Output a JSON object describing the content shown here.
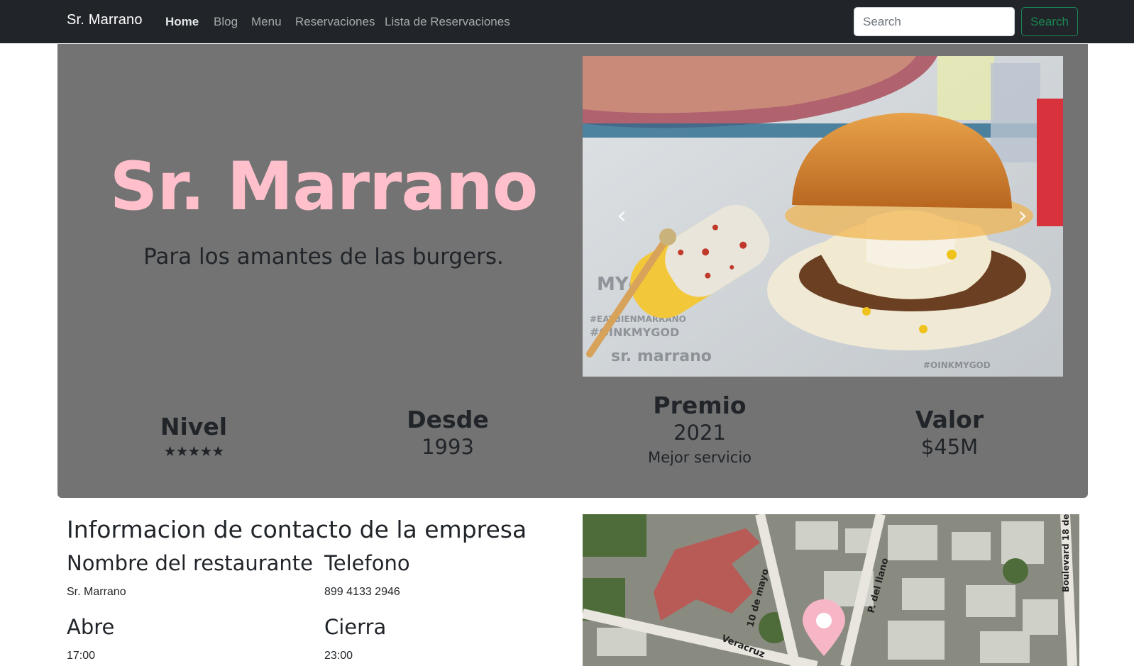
{
  "navbar": {
    "brand": "Sr. Marrano",
    "links": [
      "Home",
      "Blog",
      "Menu",
      "Reservaciones",
      "Lista de Reservaciones"
    ],
    "search_placeholder": "Search",
    "search_button": "Search"
  },
  "hero": {
    "title": "Sr. Marrano",
    "subtitle": "Para los amantes de las burgers.",
    "carousel": {
      "prev_icon": "chevron-left-icon",
      "next_icon": "chevron-right-icon"
    },
    "stats": {
      "nivel": {
        "label": "Nivel",
        "stars": "★★★★★",
        "rating": 5
      },
      "desde": {
        "label": "Desde",
        "value": "1993"
      },
      "premio": {
        "label": "Premio",
        "value": "2021",
        "note": "Mejor servicio"
      },
      "valor": {
        "label": "Valor",
        "value": "$45M"
      }
    }
  },
  "contact": {
    "title": "Informacion de contacto de la empresa",
    "name_label": "Nombre del restaurante",
    "name_value": "Sr. Marrano",
    "phone_label": "Telefono",
    "phone_value": "899 4133 2946",
    "open_label": "Abre",
    "open_value": "17:00",
    "close_label": "Cierra",
    "close_value": "23:00"
  },
  "map": {
    "streets": [
      "10 de mayo",
      "P. del llano",
      "Veracruz",
      "Boulevard 18 de"
    ],
    "marker_icon": "map-pin-icon"
  },
  "colors": {
    "navbar_bg": "#212529",
    "hero_bg": "#737373",
    "title_pink": "#ffc0cb",
    "search_green": "#198754"
  }
}
